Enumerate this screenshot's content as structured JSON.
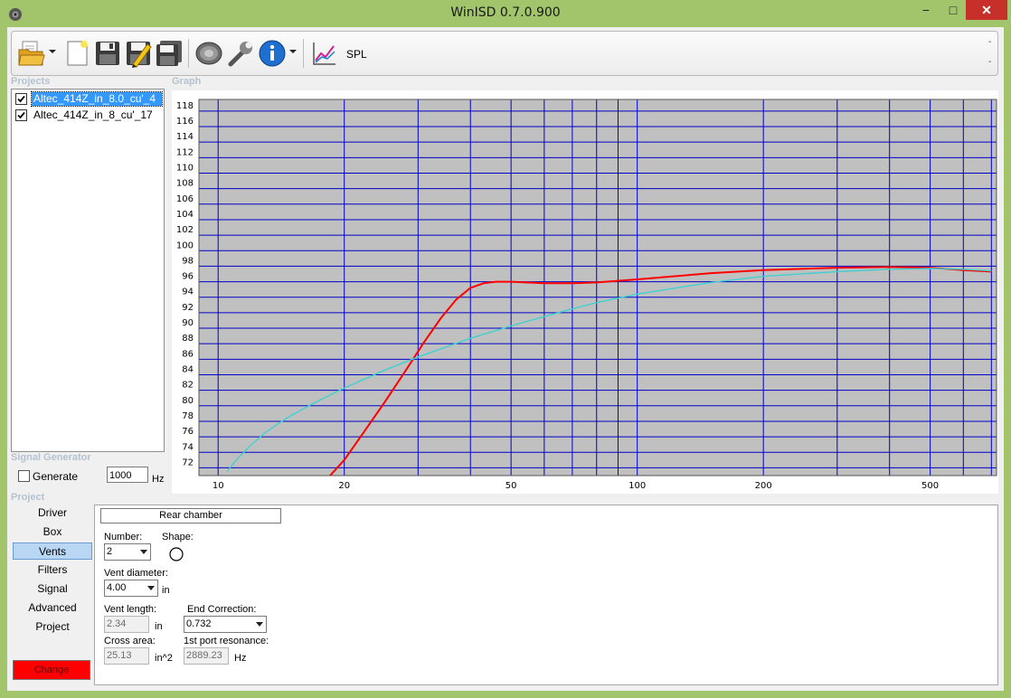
{
  "window": {
    "title": "WinISD 0.7.0.900",
    "minimize": "−",
    "maximize": "□",
    "close": "✕"
  },
  "toolbar": {
    "tools": [
      {
        "name": "open",
        "icon": "open-folder-icon"
      },
      {
        "name": "new",
        "icon": "new-document-icon"
      },
      {
        "name": "save",
        "icon": "save-icon"
      },
      {
        "name": "save-as",
        "icon": "save-as-icon"
      },
      {
        "name": "save-all",
        "icon": "save-all-icon"
      },
      {
        "name": "driver-editor",
        "icon": "speaker-icon"
      },
      {
        "name": "options",
        "icon": "wrench-icon"
      },
      {
        "name": "info",
        "icon": "info-icon"
      },
      {
        "name": "spl-graph",
        "icon": "graph-icon"
      }
    ],
    "spl_label": "SPL",
    "dash_top": "-",
    "dash_bottom": "-"
  },
  "projects": {
    "label": "Projects",
    "items": [
      {
        "name": "Altec_414Z_in_8.0_cu'_4",
        "checked": true,
        "selected": true
      },
      {
        "name": "Altec_414Z_in_8_cu'_17",
        "checked": true,
        "selected": false
      }
    ]
  },
  "graph": {
    "label": "Graph"
  },
  "chart_data": {
    "type": "line",
    "x_scale": "log",
    "xlim": [
      9,
      720
    ],
    "ylim": [
      71,
      119.5
    ],
    "x_ticks": [
      10,
      20,
      50,
      100,
      200,
      500
    ],
    "x_tick_labels": [
      "10",
      "20",
      "50",
      "100",
      "200",
      "500"
    ],
    "y_ticks": [
      72,
      74,
      76,
      78,
      80,
      82,
      84,
      86,
      88,
      90,
      92,
      94,
      96,
      98,
      100,
      102,
      104,
      106,
      108,
      110,
      112,
      114,
      116,
      118
    ],
    "x_gridlines": [
      10,
      20,
      30,
      40,
      50,
      60,
      70,
      80,
      90,
      100,
      200,
      300,
      400,
      500,
      600,
      700
    ],
    "grid": true,
    "background": "#c0c0c0",
    "grid_color": "#0000c8",
    "series": [
      {
        "color": "#ff0000",
        "x": [
          18.5,
          20,
          22,
          25,
          28,
          31,
          34,
          37,
          40,
          43,
          46,
          50,
          60,
          70,
          80,
          100,
          150,
          200,
          300,
          400,
          500,
          600,
          700
        ],
        "y": [
          71,
          73,
          76.2,
          80.5,
          84.5,
          88.2,
          91.3,
          93.7,
          95.2,
          95.8,
          96,
          96,
          95.8,
          95.8,
          95.9,
          96.3,
          97.1,
          97.5,
          97.8,
          97.9,
          97.8,
          97.5,
          97.3
        ]
      },
      {
        "color": "#40d0d0",
        "x": [
          10.5,
          11,
          12,
          13,
          14,
          15,
          17,
          20,
          25,
          30,
          40,
          50,
          60,
          70,
          80,
          100,
          150,
          200,
          300,
          400,
          500,
          600,
          700
        ],
        "y": [
          71.5,
          72.9,
          75,
          76.6,
          77.8,
          78.8,
          80.4,
          82.3,
          84.6,
          86.3,
          88.7,
          90.3,
          91.5,
          92.5,
          93.3,
          94.4,
          95.9,
          96.7,
          97.3,
          97.6,
          97.7,
          97.6,
          97.4
        ]
      }
    ]
  },
  "signal_generator": {
    "label": "Signal Generator",
    "generate_label": "Generate",
    "generate_checked": false,
    "frequency": "1000",
    "unit": "Hz"
  },
  "project_nav": {
    "label": "Project",
    "items": [
      "Driver",
      "Box",
      "Vents",
      "Filters",
      "Signal",
      "Advanced",
      "Project"
    ],
    "active": "Vents",
    "change_label": "Change",
    "change_color": "#ff0000"
  },
  "vents_panel": {
    "rear_chamber": "Rear chamber",
    "number_label": "Number:",
    "number_value": "2",
    "shape_label": "Shape:",
    "diameter_label": "Vent diameter:",
    "diameter_value": "4.00",
    "diameter_unit": "in",
    "length_label": "Vent length:",
    "length_value": "2.34",
    "length_unit": "in",
    "end_correction_label": "End Correction:",
    "end_correction_value": "0.732",
    "cross_area_label": "Cross area:",
    "cross_area_value": "25.13",
    "cross_area_unit": "in^2",
    "resonance_label": "1st port resonance:",
    "resonance_value": "2889.23",
    "resonance_unit": "Hz"
  }
}
